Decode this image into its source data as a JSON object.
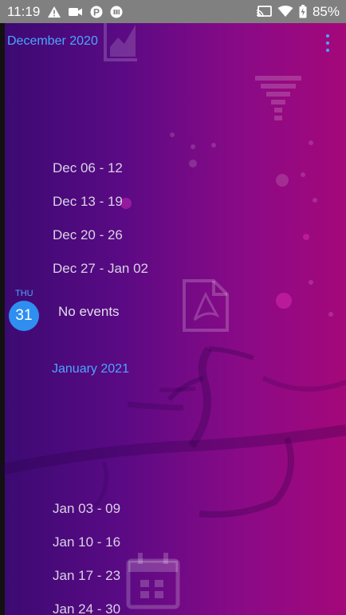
{
  "status_bar": {
    "time": "11:19",
    "battery": "85%",
    "left_icons": [
      "warning-icon",
      "camera-icon",
      "parking-icon",
      "media-icon"
    ],
    "right_icons": [
      "cast-icon",
      "wifi-icon",
      "battery-icon"
    ]
  },
  "header": {
    "month": "December 2020"
  },
  "weeks_december": [
    {
      "label": "Dec 06 - 12"
    },
    {
      "label": "Dec 13 - 19"
    },
    {
      "label": "Dec 20 - 26"
    },
    {
      "label": "Dec 27 - Jan 02"
    }
  ],
  "today": {
    "day_name": "THU",
    "day_number": "31",
    "events_text": "No events"
  },
  "next_month": {
    "label": "January 2021"
  },
  "weeks_january": [
    {
      "label": "Jan 03 - 09"
    },
    {
      "label": "Jan 10 - 16"
    },
    {
      "label": "Jan 17 - 23"
    },
    {
      "label": "Jan 24 - 30"
    }
  ],
  "colors": {
    "accent": "#4aa6ff",
    "today_badge": "#2f8ff0",
    "status_bar": "#808080"
  }
}
